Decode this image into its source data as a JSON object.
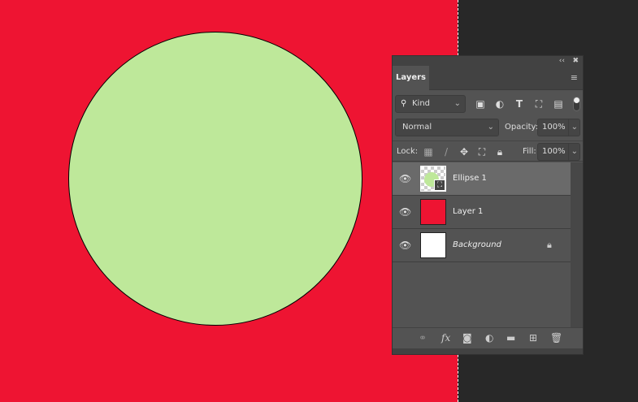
{
  "panel": {
    "title": "Layers",
    "collapse": "‹‹",
    "close": "✖",
    "menu": "≡"
  },
  "filter": {
    "kind": "Kind"
  },
  "blend": {
    "mode": "Normal",
    "opacity_label": "Opacity:",
    "opacity": "100%"
  },
  "lock": {
    "label": "Lock:",
    "fill_label": "Fill:",
    "fill": "100%"
  },
  "layers": [
    {
      "name": "Ellipse 1",
      "selected": true
    },
    {
      "name": "Layer 1"
    },
    {
      "name": "Background",
      "locked": true
    }
  ],
  "colors": {
    "canvas": "#ee1432",
    "ellipse": "#bee89a"
  }
}
